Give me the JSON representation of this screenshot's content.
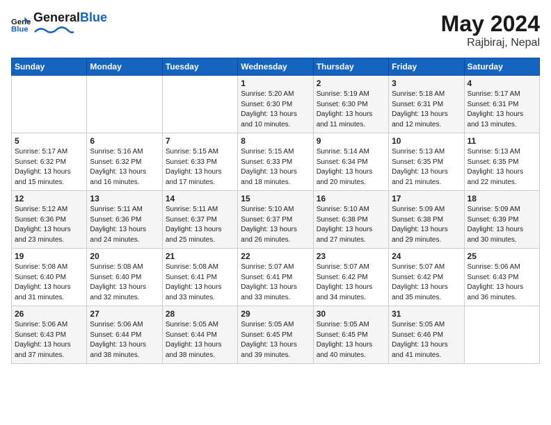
{
  "header": {
    "logo_general": "General",
    "logo_blue": "Blue",
    "month_year": "May 2024",
    "location": "Rajbiraj, Nepal"
  },
  "weekdays": [
    "Sunday",
    "Monday",
    "Tuesday",
    "Wednesday",
    "Thursday",
    "Friday",
    "Saturday"
  ],
  "weeks": [
    [
      {
        "day": "",
        "sunrise": "",
        "sunset": "",
        "daylight": ""
      },
      {
        "day": "",
        "sunrise": "",
        "sunset": "",
        "daylight": ""
      },
      {
        "day": "",
        "sunrise": "",
        "sunset": "",
        "daylight": ""
      },
      {
        "day": "1",
        "sunrise": "Sunrise: 5:20 AM",
        "sunset": "Sunset: 6:30 PM",
        "daylight": "Daylight: 13 hours and 10 minutes."
      },
      {
        "day": "2",
        "sunrise": "Sunrise: 5:19 AM",
        "sunset": "Sunset: 6:30 PM",
        "daylight": "Daylight: 13 hours and 11 minutes."
      },
      {
        "day": "3",
        "sunrise": "Sunrise: 5:18 AM",
        "sunset": "Sunset: 6:31 PM",
        "daylight": "Daylight: 13 hours and 12 minutes."
      },
      {
        "day": "4",
        "sunrise": "Sunrise: 5:17 AM",
        "sunset": "Sunset: 6:31 PM",
        "daylight": "Daylight: 13 hours and 13 minutes."
      }
    ],
    [
      {
        "day": "5",
        "sunrise": "Sunrise: 5:17 AM",
        "sunset": "Sunset: 6:32 PM",
        "daylight": "Daylight: 13 hours and 15 minutes."
      },
      {
        "day": "6",
        "sunrise": "Sunrise: 5:16 AM",
        "sunset": "Sunset: 6:32 PM",
        "daylight": "Daylight: 13 hours and 16 minutes."
      },
      {
        "day": "7",
        "sunrise": "Sunrise: 5:15 AM",
        "sunset": "Sunset: 6:33 PM",
        "daylight": "Daylight: 13 hours and 17 minutes."
      },
      {
        "day": "8",
        "sunrise": "Sunrise: 5:15 AM",
        "sunset": "Sunset: 6:33 PM",
        "daylight": "Daylight: 13 hours and 18 minutes."
      },
      {
        "day": "9",
        "sunrise": "Sunrise: 5:14 AM",
        "sunset": "Sunset: 6:34 PM",
        "daylight": "Daylight: 13 hours and 20 minutes."
      },
      {
        "day": "10",
        "sunrise": "Sunrise: 5:13 AM",
        "sunset": "Sunset: 6:35 PM",
        "daylight": "Daylight: 13 hours and 21 minutes."
      },
      {
        "day": "11",
        "sunrise": "Sunrise: 5:13 AM",
        "sunset": "Sunset: 6:35 PM",
        "daylight": "Daylight: 13 hours and 22 minutes."
      }
    ],
    [
      {
        "day": "12",
        "sunrise": "Sunrise: 5:12 AM",
        "sunset": "Sunset: 6:36 PM",
        "daylight": "Daylight: 13 hours and 23 minutes."
      },
      {
        "day": "13",
        "sunrise": "Sunrise: 5:11 AM",
        "sunset": "Sunset: 6:36 PM",
        "daylight": "Daylight: 13 hours and 24 minutes."
      },
      {
        "day": "14",
        "sunrise": "Sunrise: 5:11 AM",
        "sunset": "Sunset: 6:37 PM",
        "daylight": "Daylight: 13 hours and 25 minutes."
      },
      {
        "day": "15",
        "sunrise": "Sunrise: 5:10 AM",
        "sunset": "Sunset: 6:37 PM",
        "daylight": "Daylight: 13 hours and 26 minutes."
      },
      {
        "day": "16",
        "sunrise": "Sunrise: 5:10 AM",
        "sunset": "Sunset: 6:38 PM",
        "daylight": "Daylight: 13 hours and 27 minutes."
      },
      {
        "day": "17",
        "sunrise": "Sunrise: 5:09 AM",
        "sunset": "Sunset: 6:38 PM",
        "daylight": "Daylight: 13 hours and 29 minutes."
      },
      {
        "day": "18",
        "sunrise": "Sunrise: 5:09 AM",
        "sunset": "Sunset: 6:39 PM",
        "daylight": "Daylight: 13 hours and 30 minutes."
      }
    ],
    [
      {
        "day": "19",
        "sunrise": "Sunrise: 5:08 AM",
        "sunset": "Sunset: 6:40 PM",
        "daylight": "Daylight: 13 hours and 31 minutes."
      },
      {
        "day": "20",
        "sunrise": "Sunrise: 5:08 AM",
        "sunset": "Sunset: 6:40 PM",
        "daylight": "Daylight: 13 hours and 32 minutes."
      },
      {
        "day": "21",
        "sunrise": "Sunrise: 5:08 AM",
        "sunset": "Sunset: 6:41 PM",
        "daylight": "Daylight: 13 hours and 33 minutes."
      },
      {
        "day": "22",
        "sunrise": "Sunrise: 5:07 AM",
        "sunset": "Sunset: 6:41 PM",
        "daylight": "Daylight: 13 hours and 33 minutes."
      },
      {
        "day": "23",
        "sunrise": "Sunrise: 5:07 AM",
        "sunset": "Sunset: 6:42 PM",
        "daylight": "Daylight: 13 hours and 34 minutes."
      },
      {
        "day": "24",
        "sunrise": "Sunrise: 5:07 AM",
        "sunset": "Sunset: 6:42 PM",
        "daylight": "Daylight: 13 hours and 35 minutes."
      },
      {
        "day": "25",
        "sunrise": "Sunrise: 5:06 AM",
        "sunset": "Sunset: 6:43 PM",
        "daylight": "Daylight: 13 hours and 36 minutes."
      }
    ],
    [
      {
        "day": "26",
        "sunrise": "Sunrise: 5:06 AM",
        "sunset": "Sunset: 6:43 PM",
        "daylight": "Daylight: 13 hours and 37 minutes."
      },
      {
        "day": "27",
        "sunrise": "Sunrise: 5:06 AM",
        "sunset": "Sunset: 6:44 PM",
        "daylight": "Daylight: 13 hours and 38 minutes."
      },
      {
        "day": "28",
        "sunrise": "Sunrise: 5:05 AM",
        "sunset": "Sunset: 6:44 PM",
        "daylight": "Daylight: 13 hours and 38 minutes."
      },
      {
        "day": "29",
        "sunrise": "Sunrise: 5:05 AM",
        "sunset": "Sunset: 6:45 PM",
        "daylight": "Daylight: 13 hours and 39 minutes."
      },
      {
        "day": "30",
        "sunrise": "Sunrise: 5:05 AM",
        "sunset": "Sunset: 6:45 PM",
        "daylight": "Daylight: 13 hours and 40 minutes."
      },
      {
        "day": "31",
        "sunrise": "Sunrise: 5:05 AM",
        "sunset": "Sunset: 6:46 PM",
        "daylight": "Daylight: 13 hours and 41 minutes."
      },
      {
        "day": "",
        "sunrise": "",
        "sunset": "",
        "daylight": ""
      }
    ]
  ]
}
